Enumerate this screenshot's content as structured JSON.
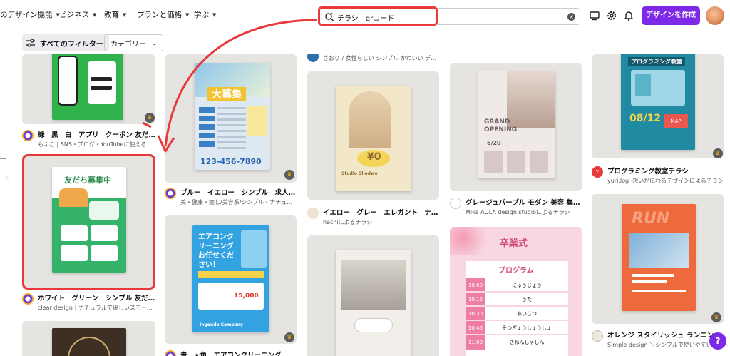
{
  "nav": {
    "items": [
      {
        "label": "のデザイン機能"
      },
      {
        "label": "ビジネス"
      },
      {
        "label": "教育"
      },
      {
        "label": "プランと価格"
      },
      {
        "label": "学ぶ"
      }
    ]
  },
  "search": {
    "value": "チラシ　qrコード"
  },
  "header": {
    "create_label": "デザインを作成"
  },
  "filters": {
    "all_filters_label": "すべてのフィルター",
    "category_label": "カテゴリー"
  },
  "colors": {
    "accent": "#7d2ae8",
    "annotation": "#e8393b",
    "crown": "#f6b400"
  },
  "cards": [
    {
      "title": "緑　黒　白　アプリ　クーポン 友だち…",
      "author": "もふこ | SNS・ブログ・YouTubeに使えるデ…"
    },
    {
      "title": "ホワイト　グリーン　シンプル 友だち…",
      "author": "clear design｜ナチュラルで優しいスモールビ…",
      "thumb_heading": "友だち募集中"
    },
    {
      "title": "ブルー　イエロー　シンプル　求人　A…",
      "author": "美・健康・癒し/美容系/シンプル・ナチュラル…",
      "thumb_heading": "大募集",
      "thumb_phone": "123-456-7890"
    },
    {
      "title": "青　★角　エアコンクリーニング　キ…",
      "author": "",
      "thumb_heading": "エアコンクリーニングお任せください！",
      "thumb_company": "Ingoude Company"
    },
    {
      "title": "",
      "author": "さおり / 女性らしい シンプル かわいい デザイ…"
    },
    {
      "title": "イエロー　グレー　エレガント　ナチ…",
      "author": "hachiによるチラシ",
      "thumb_price": "¥0",
      "thumb_studio": "Studio Shodwe"
    },
    {
      "title": "グレージュパープル モダン 美容 集客…",
      "author": "Mika AOLA design studioによるチラシ",
      "thumb_heading": "GRAND OPENING",
      "thumb_date": "6/20"
    },
    {
      "title": "",
      "author": "",
      "thumb_heading": "卒業式",
      "thumb_sub": "プログラム",
      "rows": [
        {
          "time": "10:00",
          "label": "にゅうじょう"
        },
        {
          "time": "10:15",
          "label": "うた"
        },
        {
          "time": "10:30",
          "label": "あいさつ"
        },
        {
          "time": "10:45",
          "label": "そつぎょうしょうしょ"
        },
        {
          "time": "11:00",
          "label": "きねんしゃしん"
        }
      ]
    },
    {
      "title": "プログラミング教室チラシ",
      "author": "yuri.log ·想いが伝わるデザインによるチラシ",
      "thumb_heading": "プログラミング教室",
      "thumb_date": "08/12",
      "thumb_map": "MAP"
    },
    {
      "title": "オレンジ スタイリッシュ ランニング…",
      "author": "Simple design ＼シンプルで使いやすい…",
      "thumb_heading": "RUN"
    }
  ]
}
